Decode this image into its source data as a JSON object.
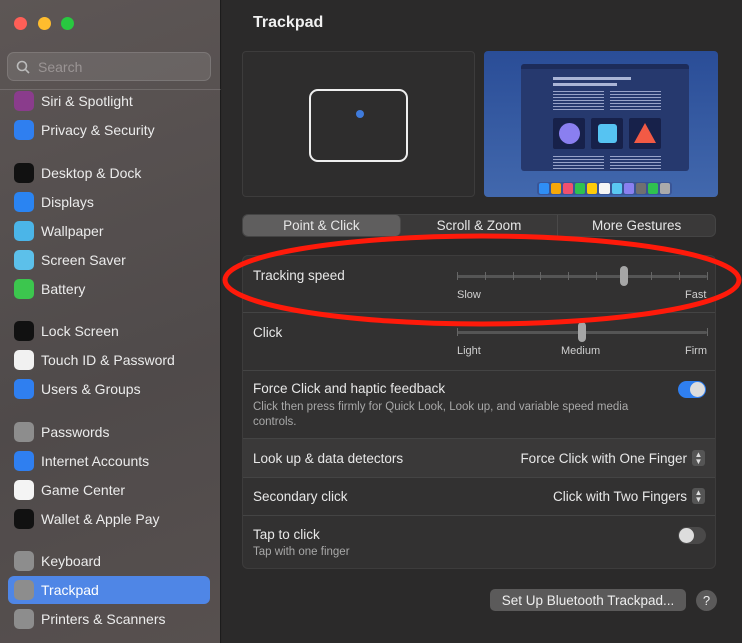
{
  "window": {
    "title": "Trackpad"
  },
  "sidebar": {
    "search_placeholder": "Search",
    "items": [
      {
        "label": "Siri & Spotlight",
        "icon": "siri-icon",
        "color": "#8a3c8c"
      },
      {
        "label": "Privacy & Security",
        "icon": "hand-icon",
        "color": "#2f7ff0"
      },
      {
        "label": "Desktop & Dock",
        "icon": "dock-icon",
        "color": "#111111"
      },
      {
        "label": "Displays",
        "icon": "sun-icon",
        "color": "#2a84f2"
      },
      {
        "label": "Wallpaper",
        "icon": "flower-icon",
        "color": "#4bb5e8"
      },
      {
        "label": "Screen Saver",
        "icon": "screensaver-icon",
        "color": "#5cc0ea"
      },
      {
        "label": "Battery",
        "icon": "battery-icon",
        "color": "#3cc64e"
      },
      {
        "label": "Lock Screen",
        "icon": "lock-icon",
        "color": "#111111"
      },
      {
        "label": "Touch ID & Password",
        "icon": "fingerprint-icon",
        "color": "#f1f1f1"
      },
      {
        "label": "Users & Groups",
        "icon": "users-icon",
        "color": "#2f7ff0"
      },
      {
        "label": "Passwords",
        "icon": "key-icon",
        "color": "#8d8d8d"
      },
      {
        "label": "Internet Accounts",
        "icon": "at-icon",
        "color": "#2f7ff0"
      },
      {
        "label": "Game Center",
        "icon": "game-center-icon",
        "color": "#f4f4f4"
      },
      {
        "label": "Wallet & Apple Pay",
        "icon": "wallet-icon",
        "color": "#111111"
      },
      {
        "label": "Keyboard",
        "icon": "keyboard-icon",
        "color": "#8d8d8d"
      },
      {
        "label": "Trackpad",
        "icon": "trackpad-icon",
        "color": "#8d8d8d",
        "selected": true
      },
      {
        "label": "Printers & Scanners",
        "icon": "printer-icon",
        "color": "#8d8d8d"
      }
    ]
  },
  "main": {
    "title": "Trackpad",
    "tabs": [
      {
        "label": "Point & Click",
        "selected": true
      },
      {
        "label": "Scroll & Zoom"
      },
      {
        "label": "More Gestures"
      }
    ],
    "tracking": {
      "label": "Tracking speed",
      "min_label": "Slow",
      "max_label": "Fast",
      "value_fraction": 0.667
    },
    "click": {
      "label": "Click",
      "labels": [
        "Light",
        "Medium",
        "Firm"
      ],
      "value_fraction": 0.5
    },
    "force": {
      "label": "Force Click and haptic feedback",
      "desc": "Click then press firmly for Quick Look, Look up, and variable speed media controls.",
      "on": true
    },
    "lookup": {
      "label": "Look up & data detectors",
      "value": "Force Click with One Finger"
    },
    "secondary": {
      "label": "Secondary click",
      "value": "Click with Two Fingers"
    },
    "tap": {
      "label": "Tap to click",
      "desc": "Tap with one finger",
      "on": false
    },
    "bt_button": "Set Up Bluetooth Trackpad...",
    "help": "?"
  },
  "colors": {
    "accent": "#2f7ff0",
    "annotation": "#ff1a0a"
  }
}
